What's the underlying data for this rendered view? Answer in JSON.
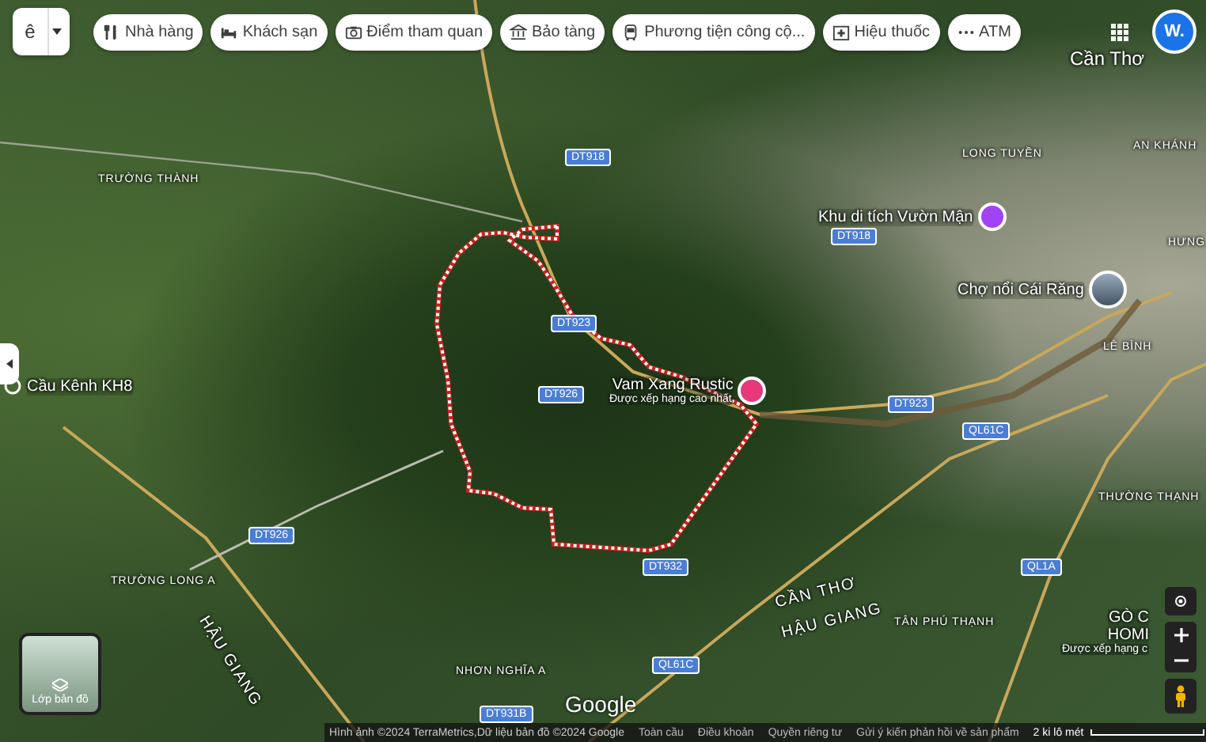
{
  "search": {
    "value": "ê"
  },
  "chips": [
    {
      "kind": "restaurant",
      "label": "Nhà hàng"
    },
    {
      "kind": "hotel",
      "label": "Khách sạn"
    },
    {
      "kind": "attraction",
      "label": "Điểm tham quan"
    },
    {
      "kind": "museum",
      "label": "Bảo tàng"
    },
    {
      "kind": "transit",
      "label": "Phương tiện công cộ..."
    },
    {
      "kind": "pharmacy",
      "label": "Hiệu thuốc"
    },
    {
      "kind": "atm",
      "label": "ATM"
    }
  ],
  "account": {
    "avatar": "W."
  },
  "map": {
    "labels": [
      {
        "kind": "city",
        "text": "Cần Thơ"
      },
      {
        "kind": "place",
        "text": "TRƯỜNG THÀNH"
      },
      {
        "kind": "place",
        "text": "LONG TUYỀN"
      },
      {
        "kind": "place",
        "text": "AN KHÁNH"
      },
      {
        "kind": "place",
        "text": "HƯNG"
      },
      {
        "kind": "place",
        "text": "LÊ BÌNH"
      },
      {
        "kind": "place",
        "text": "THƯỜNG THẠNH"
      },
      {
        "kind": "place",
        "text": "TRƯỜNG LONG A"
      },
      {
        "kind": "place",
        "text": "NHƠN NGHĨA A"
      },
      {
        "kind": "place",
        "text": "TÂN PHÚ THẠNH"
      },
      {
        "kind": "region",
        "text": "HẬU GIANG"
      },
      {
        "kind": "region",
        "text": "CẦN THƠ"
      },
      {
        "kind": "region",
        "text": "HẬU GIANG"
      },
      {
        "kind": "road",
        "text": "DT918"
      },
      {
        "kind": "road",
        "text": "DT918"
      },
      {
        "kind": "road",
        "text": "DT923"
      },
      {
        "kind": "road",
        "text": "DT926"
      },
      {
        "kind": "road",
        "text": "DT923"
      },
      {
        "kind": "road",
        "text": "QL61C"
      },
      {
        "kind": "road",
        "text": "DT926"
      },
      {
        "kind": "road",
        "text": "DT932"
      },
      {
        "kind": "road",
        "text": "QL1A"
      },
      {
        "kind": "road",
        "text": "QL61C"
      },
      {
        "kind": "road",
        "text": "DT931B"
      }
    ],
    "pois": [
      {
        "kind": "landmark",
        "name": "Khu di tích Vườn Mận"
      },
      {
        "kind": "photo",
        "name": "Chợ nổi Cái Răng"
      },
      {
        "kind": "stop",
        "name": "Cầu Kênh KH8"
      },
      {
        "kind": "hotel",
        "name": "Vam Xang Rustic",
        "subtitle": "Được xếp hạng cao nhất"
      },
      {
        "kind": "plain",
        "name": "GÒ C",
        "second_line": "HOMI",
        "subtitle": "Được xếp hạng c"
      }
    ]
  },
  "layers_button": {
    "label": "Lớp bản đồ"
  },
  "logo": "Google",
  "footer": {
    "attribution": "Hình ảnh ©2024 TerraMetrics,Dữ liệu bản đồ ©2024 Google",
    "links": [
      "Toàn cầu",
      "Điều khoản",
      "Quyền riêng tư",
      "Gửi ý kiến phản hồi về sản phẩm"
    ],
    "scale": "2 ki lô mét"
  }
}
